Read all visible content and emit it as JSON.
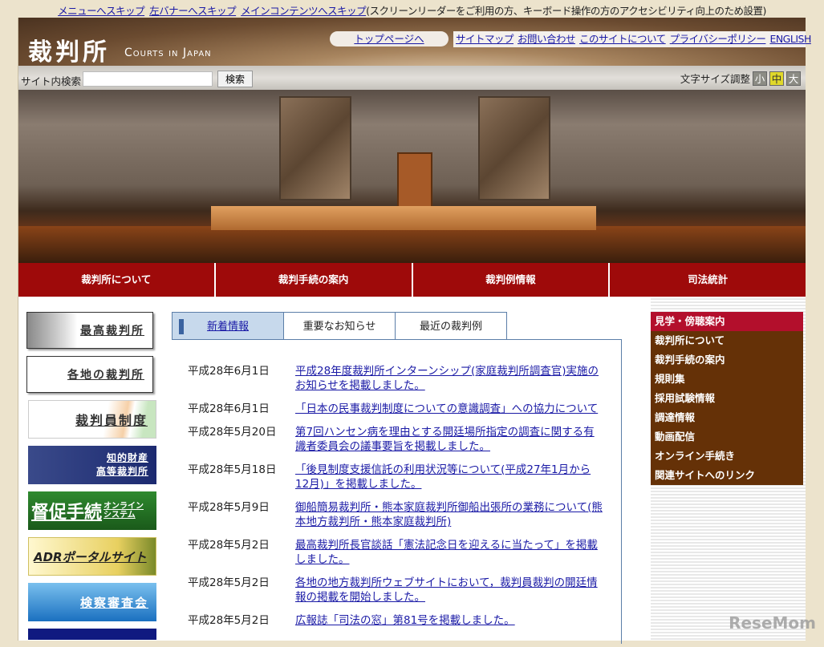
{
  "skip": {
    "links": [
      "メニューへスキップ",
      "左バナーへスキップ",
      "メインコンテンツへスキップ"
    ],
    "note": "(スクリーンリーダーをご利用の方、キーボード操作の方のアクセシビリティ向上のため設置)"
  },
  "header": {
    "logo": "裁判所",
    "logo_en": "Courts in Japan",
    "top_page": "トップページへ",
    "links": [
      "サイトマップ",
      "お問い合わせ",
      "このサイトについて",
      "プライバシーポリシー",
      "ENGLISH"
    ]
  },
  "search": {
    "label": "サイト内検索",
    "value": "",
    "button": "検索"
  },
  "font_size": {
    "label": "文字サイズ調整",
    "options": [
      "小",
      "中",
      "大"
    ],
    "selected": "中"
  },
  "nav": [
    "裁判所について",
    "裁判手続の案内",
    "裁判例情報",
    "司法統計"
  ],
  "banners": [
    "最高裁判所",
    "各地の裁判所",
    "裁判員制度",
    "知的財産",
    "高等裁判所",
    "督促手続",
    "オンラインシステム",
    "ADRポータルサイト",
    "検察審査会"
  ],
  "tabs": [
    "新着情報",
    "重要なお知らせ",
    "最近の裁判例"
  ],
  "news": [
    {
      "date": "平成28年6月1日",
      "title": "平成28年度裁判所インターンシップ(家庭裁判所調査官)実施のお知らせを掲載しました。"
    },
    {
      "date": "平成28年6月1日",
      "title": "「日本の民事裁判制度についての意識調査」への協力について"
    },
    {
      "date": "平成28年5月20日",
      "title": "第7回ハンセン病を理由とする開廷場所指定の調査に関する有識者委員会の議事要旨を掲載しました。"
    },
    {
      "date": "平成28年5月18日",
      "title": "「後見制度支援信託の利用状況等について(平成27年1月から12月)」を掲載しました。"
    },
    {
      "date": "平成28年5月9日",
      "title": "御船簡易裁判所・熊本家庭裁判所御船出張所の業務について(熊本地方裁判所・熊本家庭裁判所)"
    },
    {
      "date": "平成28年5月2日",
      "title": "最高裁判所長官談話「憲法記念日を迎えるに当たって」を掲載しました。"
    },
    {
      "date": "平成28年5月2日",
      "title": "各地の地方裁判所ウェブサイトにおいて，裁判員裁判の開廷情報の掲載を開始しました。"
    },
    {
      "date": "平成28年5月2日",
      "title": "広報誌「司法の窓」第81号を掲載しました。"
    }
  ],
  "side_menu": [
    "見学・傍聴案内",
    "裁判所について",
    "裁判手続の案内",
    "規則集",
    "採用試験情報",
    "調達情報",
    "動画配信",
    "オンライン手続き",
    "関連サイトへのリンク"
  ],
  "watermark": "ReseMom"
}
